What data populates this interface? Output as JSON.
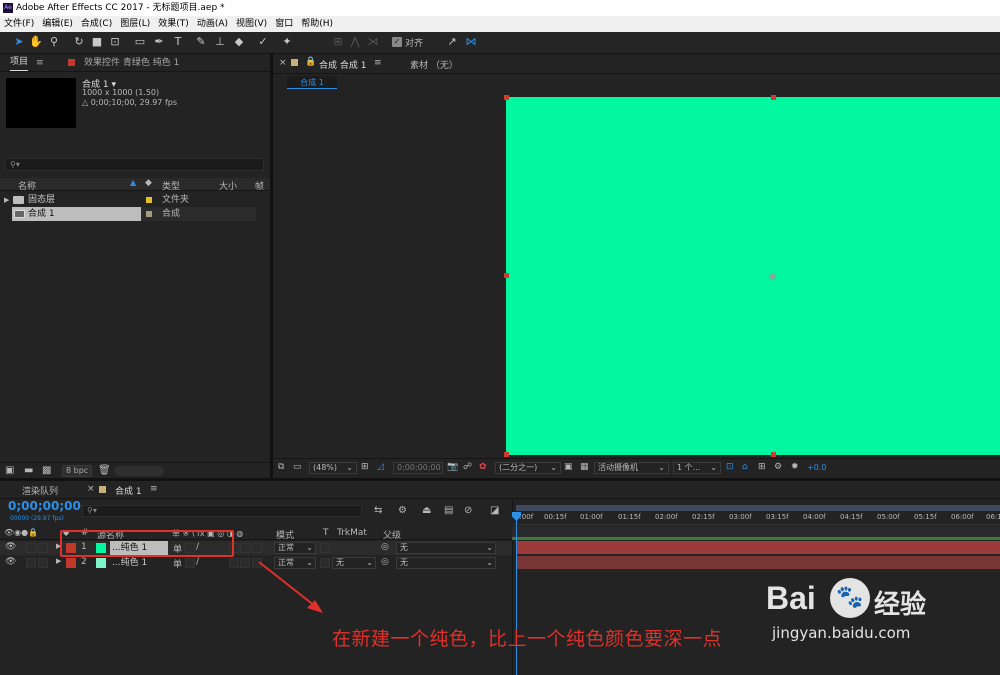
{
  "window": {
    "logo": "Ae",
    "title": "Adobe After Effects CC 2017 - 无标题项目.aep *"
  },
  "menu": [
    "文件(F)",
    "编辑(E)",
    "合成(C)",
    "图层(L)",
    "效果(T)",
    "动画(A)",
    "视图(V)",
    "窗口",
    "帮助(H)"
  ],
  "toolbar": {
    "align_label": "对齐"
  },
  "project_panel": {
    "tab_project": "项目",
    "tab_effects": "效果控件 青绿色 纯色 1",
    "comp_name": "合成 1 ▾",
    "comp_size": "1000 x 1000 (1.50)",
    "comp_duration": "△ 0;00;10;00, 29.97 fps",
    "search_icon": "⚲▾",
    "columns": {
      "name": "名称",
      "type": "类型",
      "size": "大小",
      "rate": "帧"
    },
    "items": [
      {
        "name": "固态层",
        "type": "文件夹",
        "color": "#e3c02a"
      },
      {
        "name": "合成 1",
        "type": "合成",
        "color": "#a59a7c"
      }
    ],
    "bpc": "8 bpc"
  },
  "comp_viewer": {
    "tab_label": "合成 合成 1",
    "tab_footage": "素材 （无）",
    "breadcrumb": "合成 1",
    "canvas_color": "#01f7a0",
    "zoom": "(48%)",
    "timecode": "0;00;00;00",
    "resolution": "(二分之一)",
    "camera": "活动摄像机",
    "views": "1 个...",
    "exposure": "+0.0"
  },
  "timeline": {
    "tab_render": "渲染队列",
    "tab_comp": "合成 1",
    "timecode": "0;00;00;00",
    "frame": "00000 (29.97 fps)",
    "search_icon": "⚲▾",
    "headers": {
      "num": "#",
      "source": "源名称",
      "switches": "单 ※ \\ fx ▣ ◎ ◑ ◍",
      "mode": "模式",
      "t": "T",
      "trkmat": "TrkMat",
      "parent": "父级"
    },
    "layers": [
      {
        "num": "1",
        "name": "...纯色 1",
        "swatch": "#01f7a0",
        "mode": "正常",
        "trkmat": "",
        "parent": "无"
      },
      {
        "num": "2",
        "name": "...纯色 1",
        "swatch": "#7ef5c8",
        "mode": "正常",
        "trkmat": "无",
        "parent": "无"
      }
    ],
    "ruler": [
      "0:00f",
      "00:15f",
      "01:00f",
      "01:15f",
      "02:00f",
      "02:15f",
      "03:00f",
      "03:15f",
      "04:00f",
      "04:15f",
      "05:00f",
      "05:15f",
      "06:00f",
      "06:1"
    ]
  },
  "annotation": {
    "text": "在新建一个纯色，比上一个纯色颜色要深一点"
  },
  "watermark": {
    "brand": "Bai",
    "brand2": "经验",
    "url": "jingyan.baidu.com"
  }
}
